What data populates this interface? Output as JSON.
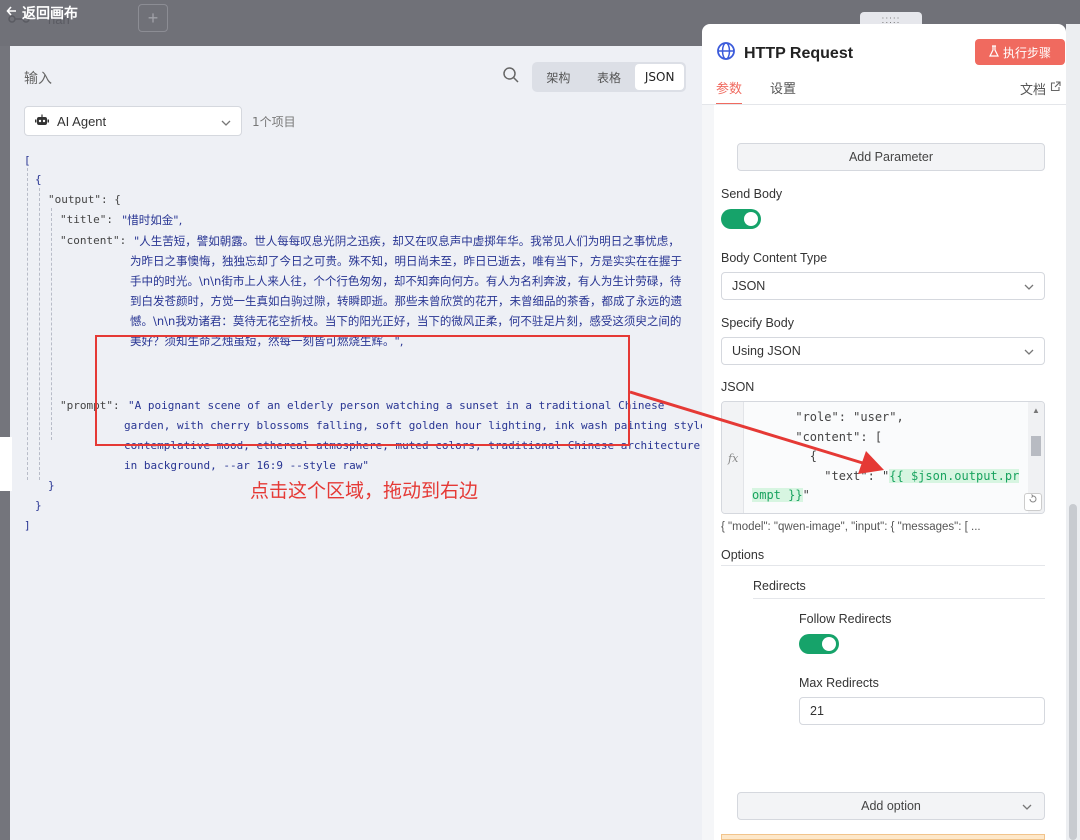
{
  "topbar": {
    "back_label": "返回画布",
    "canvas_label": "nan",
    "add_symbol": "+",
    "drag_handle": ":::::"
  },
  "input_panel": {
    "title": "输入",
    "view_tabs": [
      "架构",
      "表格",
      "JSON"
    ],
    "active_tab": "JSON",
    "source_select": "AI Agent",
    "item_count": "1个项目",
    "json": {
      "open_array": "[",
      "open_obj": "{",
      "output_key": "\"output\": {",
      "title_key": "\"title\":",
      "title_val": "\"惜时如金\",",
      "content_key": "\"content\":",
      "content_lines": [
        "\"人生苦短，譬如朝露。世人每每叹息光阴之迅疾，却又在叹息声中虚掷年华。我常见人们为明日之事忧虑，",
        "为昨日之事懊悔，独独忘却了今日之可贵。殊不知，明日尚未至，昨日已逝去，唯有当下，方是实实在在握于",
        "手中的时光。\\n\\n街市上人来人往，个个行色匆匆，却不知奔向何方。有人为名利奔波，有人为生计劳碌，待",
        "到白发苍颜时，方觉一生真如白驹过隙，转瞬即逝。那些未曾欣赏的花开，未曾细品的茶香，都成了永远的遗",
        "憾。\\n\\n我劝诸君：莫待无花空折枝。当下的阳光正好，当下的微风正柔，何不驻足片刻，感受这须臾之间的",
        "美好？须知生命之烛虽短，然每一刻皆可燃烧生辉。\","
      ],
      "prompt_key": "\"prompt\":",
      "prompt_lines": [
        "\"A poignant scene of an elderly person watching a sunset in a traditional Chinese",
        "garden, with cherry blossoms falling, soft golden hour lighting, ink wash painting style,",
        "contemplative mood, ethereal atmosphere, muted colors, traditional Chinese architecture",
        "in background, --ar 16:9 --style raw\""
      ],
      "close_inner": "}",
      "close_obj": "}",
      "close_array": "]"
    },
    "annotation": "点击这个区域，拖动到右边"
  },
  "node_panel": {
    "title": "HTTP Request",
    "run_button": "执行步骤",
    "tabs": [
      "参数",
      "设置"
    ],
    "active_tab": "参数",
    "docs_link": "文档",
    "add_parameter": "Add Parameter",
    "send_body_label": "Send Body",
    "send_body_on": true,
    "body_content_type_label": "Body Content Type",
    "body_content_type_value": "JSON",
    "specify_body_label": "Specify Body",
    "specify_body_value": "Using JSON",
    "json_label": "JSON",
    "editor_fx": "fx",
    "editor_lines": [
      "      \"role\": \"user\",",
      "      \"content\": [",
      "        {",
      "          \"text\": \""
    ],
    "editor_expr_a": "{{ $json.output.pr",
    "editor_expr_b": "ompt }}",
    "editor_tail": "\"",
    "json_preview": "{   \"model\": \"qwen-image\",   \"input\": {     \"messages\": [ ...",
    "options_label": "Options",
    "redirects_label": "Redirects",
    "follow_redirects_label": "Follow Redirects",
    "follow_redirects_on": true,
    "max_redirects_label": "Max Redirects",
    "max_redirects_value": "21",
    "add_option": "Add option"
  },
  "colors": {
    "accent": "#f06a5f",
    "toggle_on": "#16a36a",
    "annotation_red": "#e53935",
    "json_string": "#283593"
  }
}
